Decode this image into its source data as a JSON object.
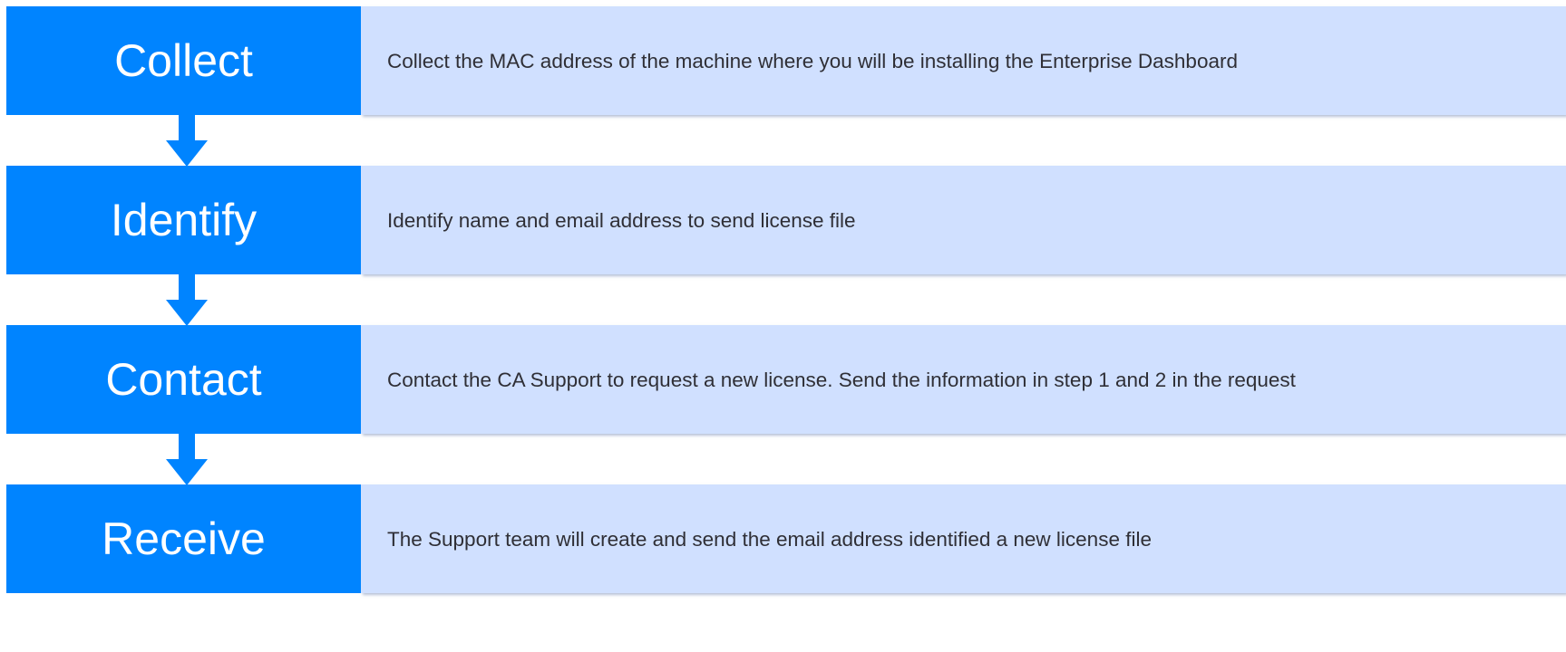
{
  "steps": [
    {
      "label": "Collect",
      "description": "Collect the MAC address of the machine where you will be installing the Enterprise Dashboard"
    },
    {
      "label": "Identify",
      "description": "Identify name and email address to send license file"
    },
    {
      "label": "Contact",
      "description": "Contact the CA Support to request a new license.  Send the information in step 1 and 2 in the request"
    },
    {
      "label": "Receive",
      "description": "The Support team will create and send the email address identified a new license file"
    }
  ],
  "colors": {
    "label_box": "#0084ff",
    "label_text": "#ffffff",
    "description_box": "#d0e0ff",
    "description_text": "#2f2f36",
    "arrow": "#0084ff"
  }
}
